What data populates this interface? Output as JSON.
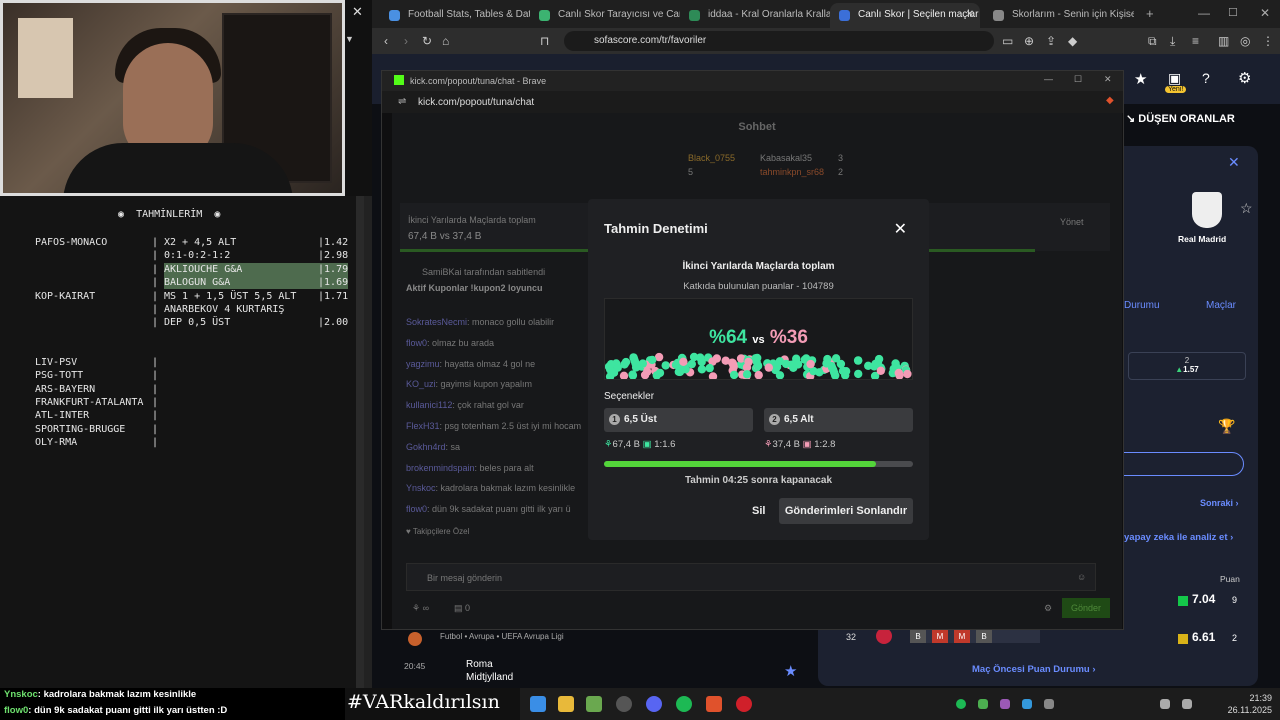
{
  "predictions": {
    "title": "TAHMİNLERİM",
    "rows": [
      {
        "match": "PAFOS-MONACO",
        "pick": "X2 + 4,5 ALT",
        "odd": "1.42"
      },
      {
        "match": "",
        "pick": "0:1-0:2-1:2",
        "odd": "2.98"
      },
      {
        "match": "",
        "pick": "AKLIOUCHE G&A",
        "odd": "1.79"
      },
      {
        "match": "",
        "pick": "BALOGUN G&A",
        "odd": "1.69"
      },
      {
        "match": "KOP-KAIRAT",
        "pick": "MS 1 + 1,5 ÜST 5,5 ALT",
        "odd": "1.71"
      },
      {
        "match": "",
        "pick": "ANARBEKOV 4 KURTARIŞ",
        "odd": ""
      },
      {
        "match": "",
        "pick": "DEP 0,5 ÜST",
        "odd": "2.00"
      }
    ],
    "upcoming": [
      "LIV-PSV",
      "PSG-TOTT",
      "ARS-BAYERN",
      "FRANKFURT-ATALANTA",
      "ATL-INTER",
      "SPORTING-BRUGGE",
      "OLY-RMA"
    ]
  },
  "browser": {
    "tabs": [
      {
        "label": "Football Stats, Tables & Data | Soc",
        "color": "#4a90e2"
      },
      {
        "label": "Canlı Skor Tarayıcısı ve Canlı Skor",
        "color": "#3cb371"
      },
      {
        "label": "iddaa - Kral Oranlarla Krallar Gibi",
        "color": "#2e8b57"
      },
      {
        "label": "Canlı Skor | Seçilen maçlar içi",
        "color": "#3b6fd8"
      },
      {
        "label": "Skorlarım - Senin için Kişiselleştir",
        "color": "#888"
      }
    ],
    "url": "sofascore.com/tr/favoriler"
  },
  "sofascore": {
    "new_badge": "Yeni!",
    "odds_label": "DÜŞEN ORANLAR",
    "team": "Real Madrid",
    "tabs": [
      "Durumu",
      "Maçlar"
    ],
    "odds_box": {
      "label": "2",
      "value": "1.57"
    },
    "next": "Sonraki",
    "ai": "yapay zeka ile analiz et",
    "points_header": "Puan",
    "row1": {
      "rating": "7.04",
      "pts": "9"
    },
    "row2": {
      "rank": "32",
      "form": [
        "B",
        "M",
        "M",
        "B"
      ],
      "rating": "6.61",
      "pts": "2"
    },
    "pre_match": "Maç Öncesi Puan Durumu",
    "league": "Futbol • Avrupa • UEFA Avrupa Ligi",
    "match_time": "20:45",
    "home": "Roma",
    "away": "Midtjylland"
  },
  "popup": {
    "title": "kick.com/popout/tuna/chat - Brave",
    "addr": "kick.com/popout/tuna/chat",
    "chat_header": "Sohbet",
    "lb": [
      {
        "name": "Black_0755",
        "score": "5"
      },
      {
        "name": "Kabasakal35",
        "score": "3"
      },
      {
        "name": "tahminkpn_sr68",
        "score": "2"
      }
    ],
    "bg_pred_title": "İkinci Yarılarda Maçlarda toplam",
    "bg_pred_a": "67,4 B",
    "bg_pred_vs": "vs",
    "bg_pred_b": "37,4 B",
    "manage": "Yönet",
    "pinned_by": "SamiBKai tarafından sabitlendi",
    "pinned": "Aktif Kuponlar !kupon2 loyuncu",
    "messages": [
      {
        "user": "SokratesNecmi",
        "text": ": monaco gollu olabilir"
      },
      {
        "user": "flow0",
        "text": ": olmaz bu arada"
      },
      {
        "user": "yagzimu",
        "text": ": hayatta olmaz 4 gol ne"
      },
      {
        "user": "KO_uzi",
        "text": ": gayimsi kupon yapalım"
      },
      {
        "user": "kullanici112",
        "text": ": çok rahat gol var"
      },
      {
        "user": "FlexH31",
        "text": ": psg totenham 2.5 üst iyi mi hocam"
      },
      {
        "user": "Gokhn4rd",
        "text": ": sa"
      },
      {
        "user": "brokenmindspain",
        "text": ": beles para alt"
      },
      {
        "user": "Ynskoc",
        "text": ": kadrolara bakmak lazım kesinlikle"
      },
      {
        "user": "flow0",
        "text": ": dün 9k sadakat puanı gitti ilk yarı ü"
      }
    ],
    "followers_only": "Takipçilere Özel",
    "input_placeholder": "Bir mesaj gönderin",
    "count": "0",
    "send": "Gönder"
  },
  "modal": {
    "title": "Tahmin Denetimi",
    "question": "İkinci Yarılarda Maçlarda toplam",
    "contributed": "Katkıda bulunulan puanlar - 104789",
    "pct_a": "%64",
    "vs": "vs",
    "pct_b": "%36",
    "options_label": "Seçenekler",
    "option_a": {
      "num": "1",
      "label": "6,5 Üst",
      "points": "67,4 B",
      "ratio": "1:1.6"
    },
    "option_b": {
      "num": "2",
      "label": "6,5 Alt",
      "points": "37,4 B",
      "ratio": "1:2.8"
    },
    "progress": 0.88,
    "timer": "Tahmin 04:25 sonra kapanacak",
    "delete": "Sil",
    "end": "Gönderimleri Sonlandır",
    "colors": {
      "a": "#3ee5a0",
      "b": "#f49cb6"
    }
  },
  "overlay_chat": [
    {
      "user": "Ynskoc",
      "text": ": kadrolara bakmak lazım kesinlikle"
    },
    {
      "user": "flow0",
      "text": ": dün 9k sadakat puanı gitti ilk yarı üstten :D"
    }
  ],
  "hashtag": "#VARkaldırılsın",
  "clock": {
    "time": "21:39",
    "date": "26.11.2025"
  }
}
